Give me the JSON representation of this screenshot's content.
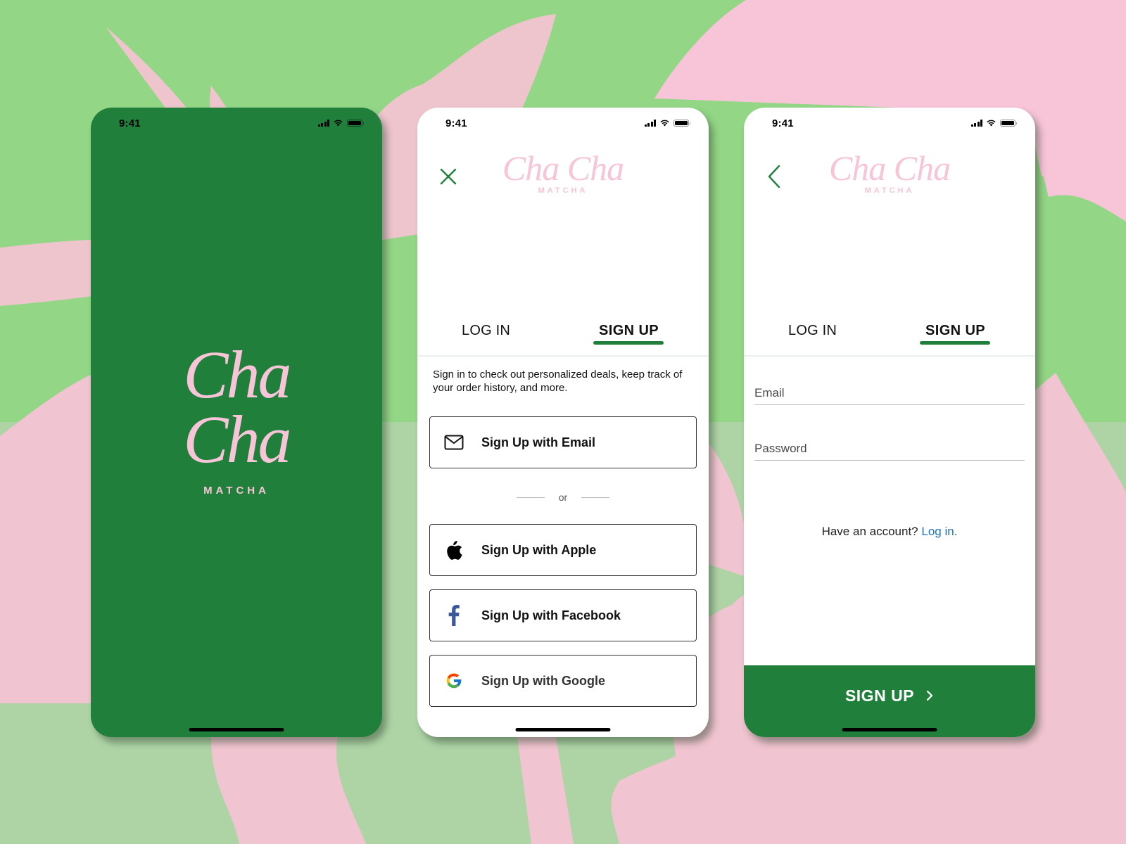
{
  "colors": {
    "brand_green": "#20803b",
    "brand_pink": "#f7c4d8",
    "background_green": "#93d686",
    "background_pink": "#f0c4d2",
    "link_blue": "#1b72c4",
    "facebook_blue": "#3b5998"
  },
  "status_bar": {
    "time": "9:41",
    "icons": [
      "cellular-signal-icon",
      "wifi-icon",
      "battery-icon"
    ]
  },
  "splash": {
    "brand_line_1": "Cha",
    "brand_line_2": "Cha",
    "brand_sub": "MATCHA"
  },
  "header": {
    "brand": "Cha Cha",
    "brand_sub": "MATCHA"
  },
  "tabs": [
    {
      "label": "LOG IN",
      "active": false
    },
    {
      "label": "SIGN UP",
      "active": true
    }
  ],
  "signup_options": {
    "intro": "Sign in to check out personalized deals, keep track of your order history, and more.",
    "email_label": "Sign Up with Email",
    "divider": "or",
    "apple_label": "Sign Up with Apple",
    "facebook_label": "Sign Up with Facebook",
    "google_label": "Sign Up with Google"
  },
  "signup_form": {
    "email_placeholder": "Email",
    "password_placeholder": "Password",
    "account_prompt": "Have an account?",
    "login_link": "Log in.",
    "submit_label": "SIGN UP"
  }
}
